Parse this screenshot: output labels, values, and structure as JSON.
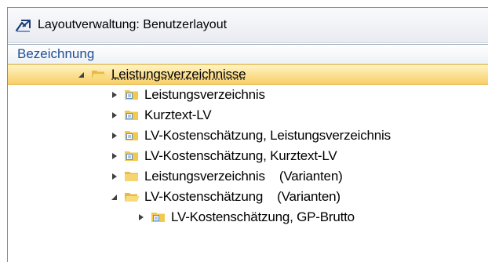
{
  "window": {
    "title": "Layoutverwaltung: Benutzerlayout",
    "icon": "layout-arrow-icon"
  },
  "grid": {
    "column_header": "Bezeichnung",
    "rows": [
      {
        "label": "Leistungsverzeichnisse",
        "state": "expanded",
        "folder": "open",
        "selected": true
      },
      {
        "label": "Leistungsverzeichnis",
        "state": "collapsed",
        "folder": "layout",
        "selected": false
      },
      {
        "label": "Kurztext-LV",
        "state": "collapsed",
        "folder": "layout",
        "selected": false
      },
      {
        "label": "LV-Kostenschätzung, Leistungsverzeichnis",
        "state": "collapsed",
        "folder": "layout",
        "selected": false
      },
      {
        "label": "LV-Kostenschätzung, Kurztext-LV",
        "state": "collapsed",
        "folder": "layout",
        "selected": false
      },
      {
        "label": "Leistungsverzeichnis    (Varianten)",
        "state": "collapsed",
        "folder": "closed",
        "selected": false
      },
      {
        "label": "LV-Kostenschätzung    (Varianten)",
        "state": "expanded",
        "folder": "open",
        "selected": false
      },
      {
        "label": "LV-Kostenschätzung, GP-Brutto",
        "state": "collapsed",
        "folder": "layout",
        "selected": false
      }
    ]
  },
  "colors": {
    "header_text": "#1f4f98",
    "selection": "#f7cf68",
    "folder": "#f2c94c"
  }
}
